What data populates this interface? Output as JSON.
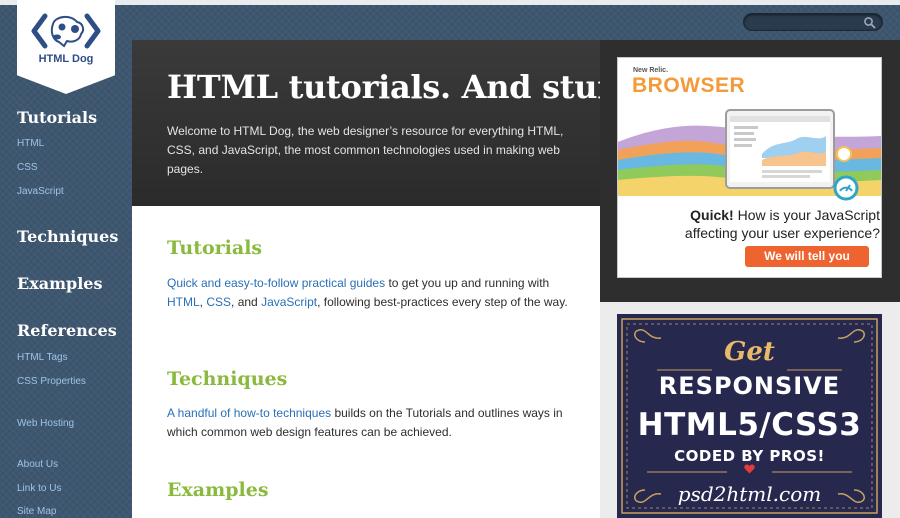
{
  "logo": {
    "name": "HTML Dog",
    "mark_color": "#2e4e86"
  },
  "search": {
    "value": "",
    "placeholder": ""
  },
  "sidebar": {
    "tutorials": {
      "heading": "Tutorials",
      "links": [
        "HTML",
        "CSS",
        "JavaScript"
      ]
    },
    "techniques": {
      "heading": "Techniques"
    },
    "examples": {
      "heading": "Examples"
    },
    "references": {
      "heading": "References",
      "links": [
        "HTML Tags",
        "CSS Properties"
      ]
    },
    "extra_links": [
      "Web Hosting",
      "About Us",
      "Link to Us",
      "Site Map"
    ]
  },
  "hero": {
    "title": "HTML tutorials. And stuff.",
    "description": "Welcome to HTML Dog, the web designer’s resource for everything HTML, CSS, and JavaScript, the most common technologies used in making web pages."
  },
  "sections": {
    "tutorials": {
      "title": "Tutorials",
      "link_guides": "Quick and easy-to-follow practical guides",
      "text_1": " to get you up and running with ",
      "link_html": "HTML",
      "sep_1": ", ",
      "link_css": "CSS",
      "sep_2": ", and ",
      "link_js": "JavaScript",
      "text_2": ", following best-practices every step of the way."
    },
    "techniques": {
      "title": "Techniques",
      "link": "A handful of how-to techniques",
      "text": " builds on the Tutorials and outlines ways in which common web design features can be achieved."
    },
    "examples": {
      "title": "Examples"
    }
  },
  "ads": {
    "newrelic": {
      "brand": "New Relic.",
      "product": "BROWSER",
      "highlight": "Quick!",
      "line1": " How is your JavaScript",
      "line2": "affecting your user experience?",
      "button": "We will tell you",
      "accent": "#ee6430"
    },
    "psd2html": {
      "get": "Get",
      "line1": "RESPONSIVE",
      "line2": "HTML5/CSS3",
      "line3": "CODED BY PROS!",
      "url": "psd2html.com",
      "accent": "#e9b96a"
    }
  },
  "colors": {
    "sidebar_bg": "#3e5770",
    "hero_bg": "#2f2f2f",
    "section_title": "#8aba3d",
    "link": "#2a6fb8",
    "sidebar_link": "#9ec4e8"
  }
}
